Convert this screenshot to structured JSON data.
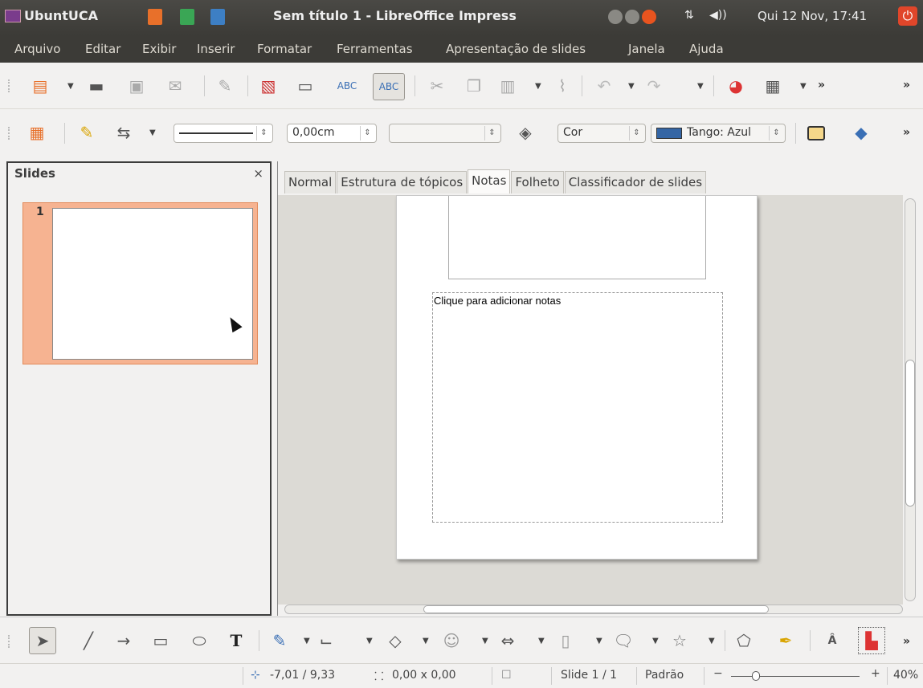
{
  "topbar": {
    "app_name": "UbuntUCA",
    "window_title": "Sem título 1 - LibreOffice Impress",
    "clock": "Qui 12 Nov, 17:41",
    "tray_network": "⇅",
    "tray_volume": "◀))"
  },
  "menubar": [
    "Arquivo",
    "Editar",
    "Exibir",
    "Inserir",
    "Formatar",
    "Ferramentas",
    "Apresentação de slides",
    "Janela",
    "Ajuda"
  ],
  "toolbar2": {
    "line_width": "0,00cm",
    "area_style": "Cor",
    "area_color": "Tango: Azul"
  },
  "slides_pane": {
    "title": "Slides",
    "close": "×",
    "slide_number": "1"
  },
  "tabs": [
    "Normal",
    "Estrutura de tópicos",
    "Notas",
    "Folheto",
    "Classificador de slides"
  ],
  "active_tab": "Notas",
  "notes": {
    "placeholder": "Clique para adicionar notas"
  },
  "statusbar": {
    "position": "-7,01 / 9,33",
    "size": "0,00 x 0,00",
    "slide": "Slide 1 / 1",
    "layout": "Padrão",
    "zoom": "40%"
  },
  "colors": {
    "panel_bg": "#3c3b37",
    "accent_orange": "#f6b391",
    "power": "#e0462a"
  }
}
